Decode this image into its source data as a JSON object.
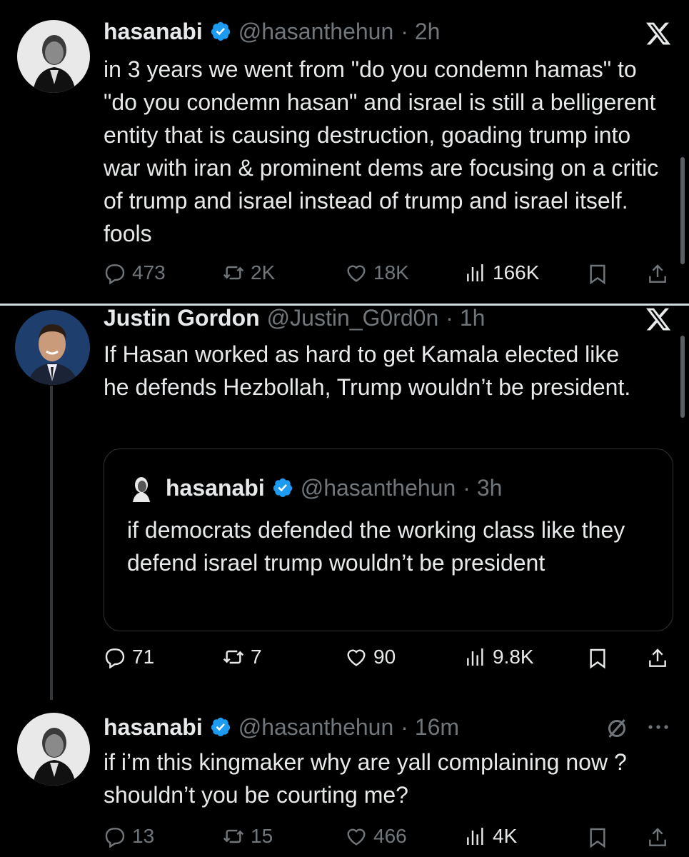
{
  "tweet1": {
    "name": "hasanabi",
    "handle": "@hasanthehun",
    "time": "· 2h",
    "text": "in 3 years we went from \"do you condemn hamas\" to \"do you condemn hasan\" and israel is still a belligerent entity that is causing destruction, goading trump into war with iran & prominent dems are focusing on a critic of trump and israel instead of trump and israel itself. fools",
    "replies": "473",
    "reposts": "2K",
    "likes": "18K",
    "views": "166K"
  },
  "tweet2": {
    "name": "Justin Gordon",
    "handle": "@Justin_G0rd0n",
    "time": "· 1h",
    "text": "If Hasan worked as hard to get Kamala elected like he defends Hezbollah, Trump wouldn’t be president.",
    "quote": {
      "name": "hasanabi",
      "handle": "@hasanthehun",
      "time": "· 3h",
      "text": "if democrats defended the working class like they defend israel trump wouldn’t be president"
    },
    "replies": "71",
    "reposts": "7",
    "likes": "90",
    "views": "9.8K"
  },
  "tweet3": {
    "name": "hasanabi",
    "handle": "@hasanthehun",
    "time": "· 16m",
    "text": "if i’m this kingmaker why are yall complaining now ? shouldn’t you be courting me?",
    "replies": "13",
    "reposts": "15",
    "likes": "466",
    "views": "4K"
  },
  "colors": {
    "verified": "#1d9bf0",
    "muted": "#71767b",
    "text": "#e7e9ea",
    "background": "#000000"
  },
  "icons": [
    "reply-icon",
    "repost-icon",
    "like-icon",
    "views-icon",
    "bookmark-icon",
    "share-icon",
    "x-logo-icon",
    "verified-badge-icon",
    "grok-icon",
    "more-icon"
  ]
}
